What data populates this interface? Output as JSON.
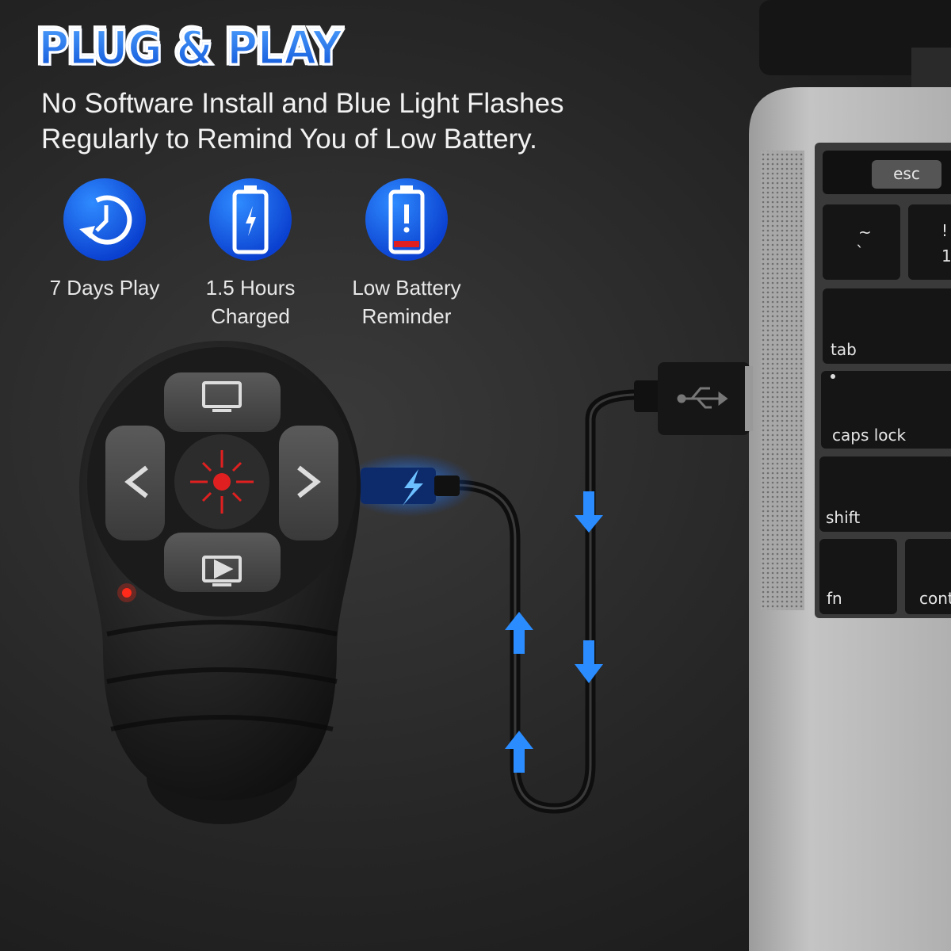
{
  "headline": "PLUG & PLAY",
  "subtitle": {
    "line1": "No Software Install and Blue Light Flashes",
    "line2": "Regularly to Remind You of Low Battery."
  },
  "features": [
    {
      "icon": "clock-refresh-icon",
      "line1": "7 Days Play",
      "line2": ""
    },
    {
      "icon": "battery-charging-icon",
      "line1": "1.5 Hours",
      "line2": "Charged"
    },
    {
      "icon": "battery-low-alert-icon",
      "line1": "Low Battery",
      "line2": "Reminder"
    }
  ],
  "keyboard": {
    "esc": "esc",
    "tilde_top": "~",
    "tilde_bottom": "`",
    "one_top": "!",
    "one_bottom": "1",
    "tab": "tab",
    "caps_lock": "caps lock",
    "shift": "shift",
    "fn": "fn",
    "control": "control"
  },
  "colors": {
    "accent_blue": "#1a6cf0",
    "laser_red": "#e02020",
    "laptop_silver": "#b8b8b8",
    "background": "#262626"
  }
}
